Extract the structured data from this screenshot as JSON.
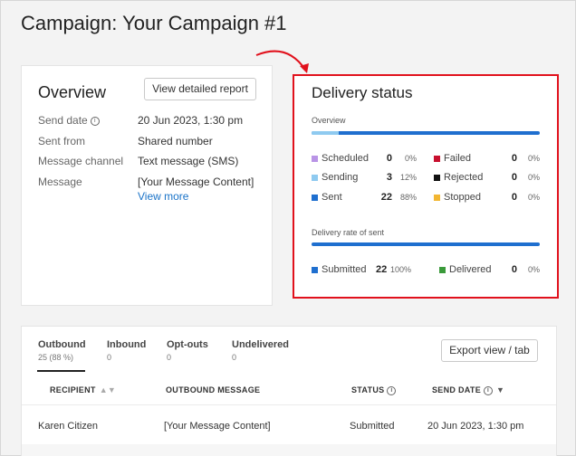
{
  "page": {
    "title": "Campaign: Your Campaign #1"
  },
  "overview": {
    "title": "Overview",
    "report_button": "View detailed report",
    "rows": [
      {
        "label": "Send date",
        "value": "20 Jun 2023, 1:30 pm"
      },
      {
        "label": "Sent from",
        "value": "Shared number"
      },
      {
        "label": "Message channel",
        "value": "Text message (SMS)"
      },
      {
        "label": "Message",
        "value": "[Your Message Content]"
      }
    ],
    "view_more": "View more"
  },
  "delivery": {
    "title": "Delivery status",
    "overview_label": "Overview",
    "overview_bar": {
      "sending_fraction": 0.12,
      "sent_fraction": 0.88
    },
    "stats": [
      {
        "label": "Scheduled",
        "count": "0",
        "pct": "0%",
        "color": "#b994e6"
      },
      {
        "label": "Sending",
        "count": "3",
        "pct": "12%",
        "color": "#8fcaf0"
      },
      {
        "label": "Sent",
        "count": "22",
        "pct": "88%",
        "color": "#1f6fcf"
      },
      {
        "label": "Failed",
        "count": "0",
        "pct": "0%",
        "color": "#c8102e"
      },
      {
        "label": "Rejected",
        "count": "0",
        "pct": "0%",
        "color": "#111111"
      },
      {
        "label": "Stopped",
        "count": "0",
        "pct": "0%",
        "color": "#f2b632"
      }
    ],
    "rate_label": "Delivery rate of sent",
    "rate_bar": {
      "submitted_fraction": 1.0
    },
    "rate_stats": [
      {
        "label": "Submitted",
        "count": "22",
        "pct": "100%",
        "color": "#1f6fcf"
      },
      {
        "label": "Delivered",
        "count": "0",
        "pct": "0%",
        "color": "#3a9a3a"
      }
    ],
    "highlight_color": "#e1111c"
  },
  "messages": {
    "tabs": [
      {
        "label": "Outbound",
        "count": "25 (88 %)"
      },
      {
        "label": "Inbound",
        "count": "0"
      },
      {
        "label": "Opt-outs",
        "count": "0"
      },
      {
        "label": "Undelivered",
        "count": "0"
      }
    ],
    "export_button": "Export view / tab",
    "columns": [
      "RECIPIENT",
      "OUTBOUND MESSAGE",
      "STATUS",
      "SEND DATE"
    ],
    "rows": [
      {
        "recipient": "Karen Citizen",
        "message": "[Your Message Content]",
        "status": "Submitted",
        "send_date": "20 Jun 2023, 1:30 pm"
      }
    ]
  }
}
